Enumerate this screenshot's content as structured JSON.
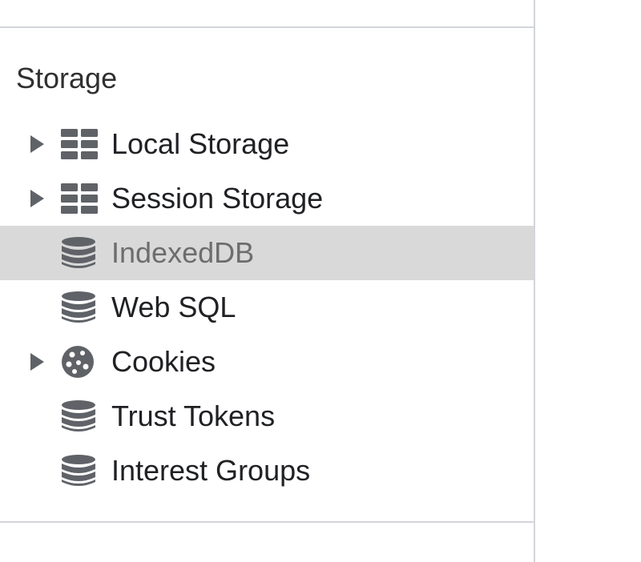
{
  "storage": {
    "title": "Storage",
    "items": [
      {
        "label": "Local Storage",
        "icon": "table-icon",
        "expandable": true,
        "selected": false
      },
      {
        "label": "Session Storage",
        "icon": "table-icon",
        "expandable": true,
        "selected": false
      },
      {
        "label": "IndexedDB",
        "icon": "database-icon",
        "expandable": false,
        "selected": true
      },
      {
        "label": "Web SQL",
        "icon": "database-icon",
        "expandable": false,
        "selected": false
      },
      {
        "label": "Cookies",
        "icon": "cookie-icon",
        "expandable": true,
        "selected": false
      },
      {
        "label": "Trust Tokens",
        "icon": "database-icon",
        "expandable": false,
        "selected": false
      },
      {
        "label": "Interest Groups",
        "icon": "database-icon",
        "expandable": false,
        "selected": false
      }
    ]
  },
  "colors": {
    "icon": "#5f6368",
    "selected_bg": "#d9d9d9",
    "divider": "#d2d5da",
    "text": "#202124"
  }
}
